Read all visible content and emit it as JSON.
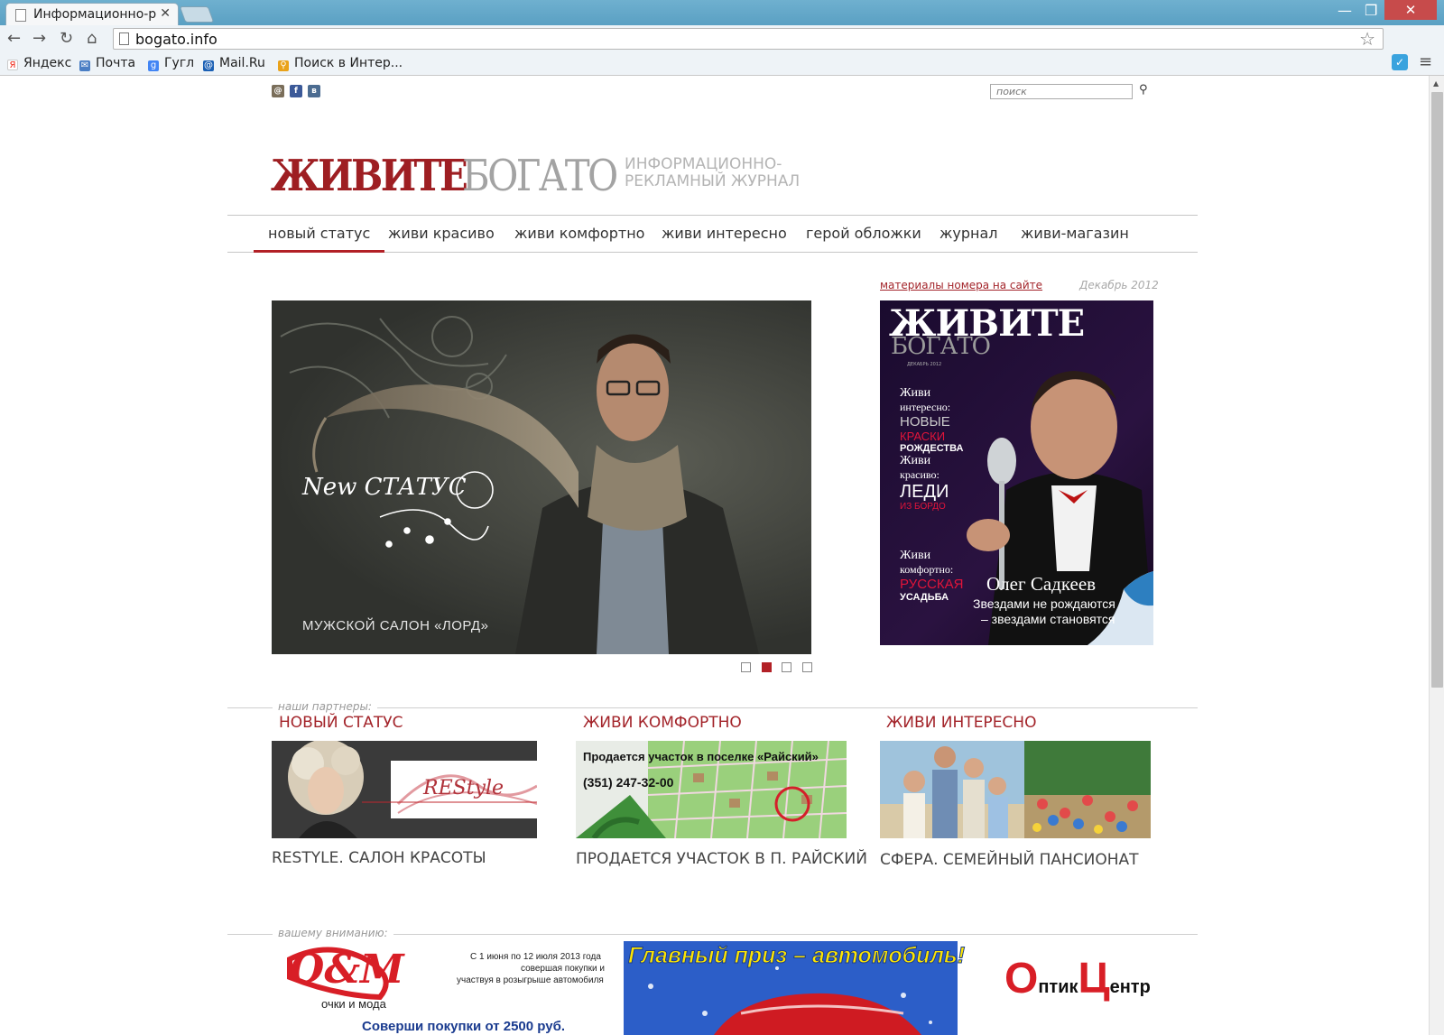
{
  "browser": {
    "tab_title": "Информационно-р",
    "url": "bogato.info",
    "bookmarks": [
      "Яндекс",
      "Почта",
      "Гугл",
      "Mail.Ru",
      "Поиск в Интер..."
    ]
  },
  "site": {
    "search_placeholder": "поиск",
    "logo_red": "ЖИВИТЕ",
    "logo_grey": "БОГАТО",
    "tagline_1": "ИНФОРМАЦИОННО-",
    "tagline_2": "РЕКЛАМНЫЙ ЖУРНАЛ",
    "nav": [
      "новый статус",
      "живи красиво",
      "живи комфортно",
      "живи интересно",
      "герой обложки",
      "журнал",
      "живи-магазин"
    ],
    "hero": {
      "brand": "New СТАТУС",
      "caption": "МУЖСКОЙ САЛОН «ЛОРД»",
      "slides": 4,
      "active_slide": 2
    },
    "issue": {
      "link": "материалы номера на сайте",
      "date": "Декабрь 2012",
      "cover_title_1": "ЖИВИТЕ",
      "cover_title_2": "БОГАТО",
      "cover_date": "ДЕКАБРЬ 2012",
      "blurb1_a": "Живи",
      "blurb1_b": "интересно:",
      "blurb1_c": "НОВЫЕ",
      "blurb1_d": "КРАСКИ",
      "blurb1_e": "РОЖДЕСТВА",
      "blurb2_a": "Живи",
      "blurb2_b": "красиво:",
      "blurb2_c": "ЛЕДИ",
      "blurb2_d": "ИЗ БОРДО",
      "blurb3_a": "Живи",
      "blurb3_b": "комфортно:",
      "blurb3_c": "РУССКАЯ",
      "blurb3_d": "УСАДЬБА",
      "hero_name": "Олег Садкеев",
      "hero_quote_1": "Звездами не рождаются",
      "hero_quote_2": "– звездами становятся"
    },
    "partners_label": "наши партнеры:",
    "partners": [
      {
        "category": "НОВЫЙ СТАТУС",
        "caption": "RESTYLE. САЛОН КРАСОТЫ",
        "logo": "REStyle"
      },
      {
        "category": "ЖИВИ КОМФОРТНО",
        "caption": "ПРОДАЕТСЯ УЧАСТОК В П. РАЙСКИЙ",
        "ad_line1": "Продается участок в поселке «Райский»",
        "ad_phone": "(351) 247-32-00"
      },
      {
        "category": "ЖИВИ ИНТЕРЕСНО",
        "caption": "СФЕРА. СЕМЕЙНЫЙ ПАНСИОНАТ"
      }
    ],
    "attention_label": "вашему вниманию:",
    "banner": {
      "brand": "О&М",
      "brand_sub": "очки и мода",
      "promo_1": "С 1 июня по 12 июля 2013 года",
      "promo_2": "совершая покупки и",
      "promo_3": "участвуя в розыгрыше автомобиля",
      "prize": "Главный приз – автомобиль!",
      "cta": "Соверши покупки от 2500 руб.",
      "right_brand_a": "О",
      "right_brand_b": "птик",
      "right_brand_c": "Ц",
      "right_brand_d": "ентр"
    }
  },
  "colors": {
    "brand_red": "#9e1e22",
    "accent_red": "#b22026",
    "grey": "#a3a3a3"
  }
}
